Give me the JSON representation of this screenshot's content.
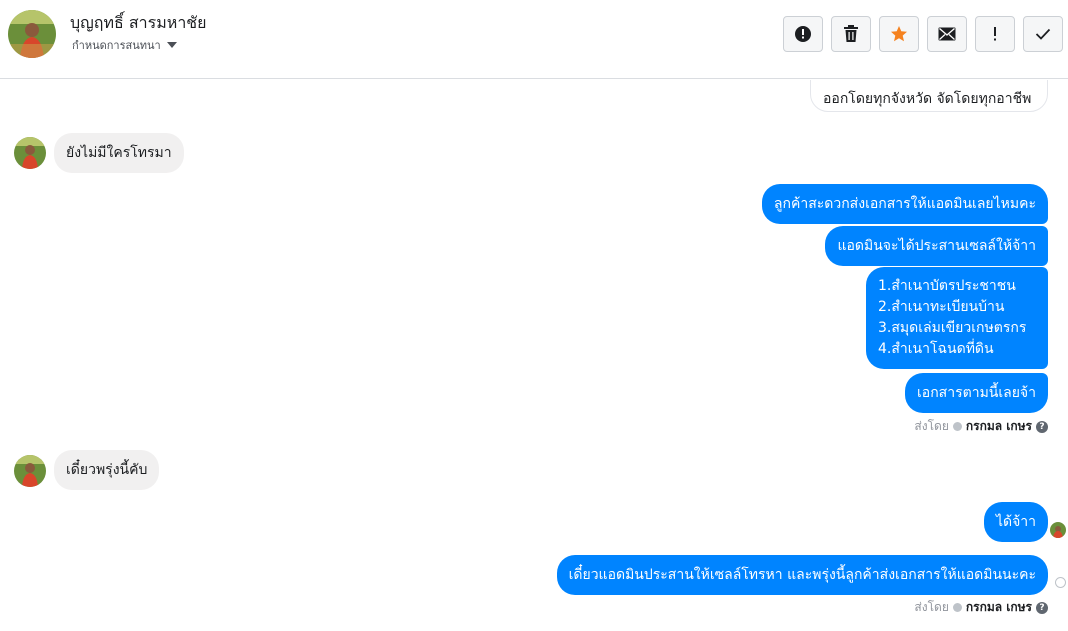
{
  "header": {
    "contact_name": "บุญฤทธิ์ สารมหาชัย",
    "assign_label": "กำหนดการสนทนา",
    "buttons": [
      {
        "name": "mark-spam-button",
        "icon": "alert-circle-icon"
      },
      {
        "name": "delete-button",
        "icon": "trash-icon"
      },
      {
        "name": "star-button",
        "icon": "star-icon"
      },
      {
        "name": "mark-unread-button",
        "icon": "envelope-icon"
      },
      {
        "name": "follow-up-button",
        "icon": "exclamation-icon"
      },
      {
        "name": "mark-done-button",
        "icon": "check-icon"
      }
    ]
  },
  "colors": {
    "outgoing_bubble": "#0084ff",
    "incoming_bubble": "#f1f0f0",
    "star": "#f5821f"
  },
  "messages": {
    "cut_top": "ออกโดยทุกจังหวัด จัดโดยทุกอาชีพ",
    "in_1": "ยังไม่มีใครโทรมา",
    "out_1": "ลูกค้าสะดวกส่งเอกสารให้แอดมินเลยไหมคะ",
    "out_2": "แอดมินจะได้ประสานเซลล์ให้จ้าา",
    "out_3_lines": [
      "1.สำเนาบัตรประชาชน",
      "2.สำเนาทะเบียนบ้าน",
      "3.สมุดเล่มเขียวเกษตรกร",
      "4.สำเนาโฉนดที่ดิน"
    ],
    "out_4": "เอกสารตามนี้เลยจ้า",
    "in_2": "เดี๋ยวพรุ่งนี้คับ",
    "out_5": "ได้จ้าา",
    "out_6": "เดี๋ยวแอดมินประสานให้เซลล์โทรหา และพรุ่งนี้ลูกค้าส่งเอกสารให้แอดมินนะคะ"
  },
  "sent_by": {
    "prefix": "ส่งโดย",
    "agent": "กรกมล เกษร",
    "help": "?"
  }
}
